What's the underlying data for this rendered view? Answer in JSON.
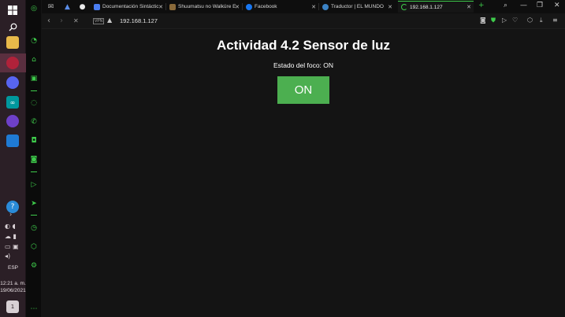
{
  "taskbar": {
    "language": "ESP",
    "time": "12:21 a. m.",
    "date": "19/06/2021",
    "notification_count": "1"
  },
  "tabs": [
    {
      "label": "Documentación Sintáctic",
      "favicon_color": "#4a7df0"
    },
    {
      "label": "Shuumatsu no Walküre E",
      "favicon_color": "#8a6a3a"
    },
    {
      "label": "Facebook",
      "favicon_color": "#1877f2"
    },
    {
      "label": "Traductor | EL MUNDO",
      "favicon_color": "#3b82c4"
    },
    {
      "label": "192.168.1.127",
      "favicon_color": "#3ecb4b"
    }
  ],
  "addressbar": {
    "vpn_label": "VPN",
    "url": "192.168.1.127"
  },
  "page": {
    "title": "Actividad 4.2 Sensor de luz",
    "status": "Estado del foco: ON",
    "button_label": "ON"
  },
  "colors": {
    "accent": "#3ecb4b",
    "button": "#4caf50",
    "page_bg": "#141414"
  }
}
